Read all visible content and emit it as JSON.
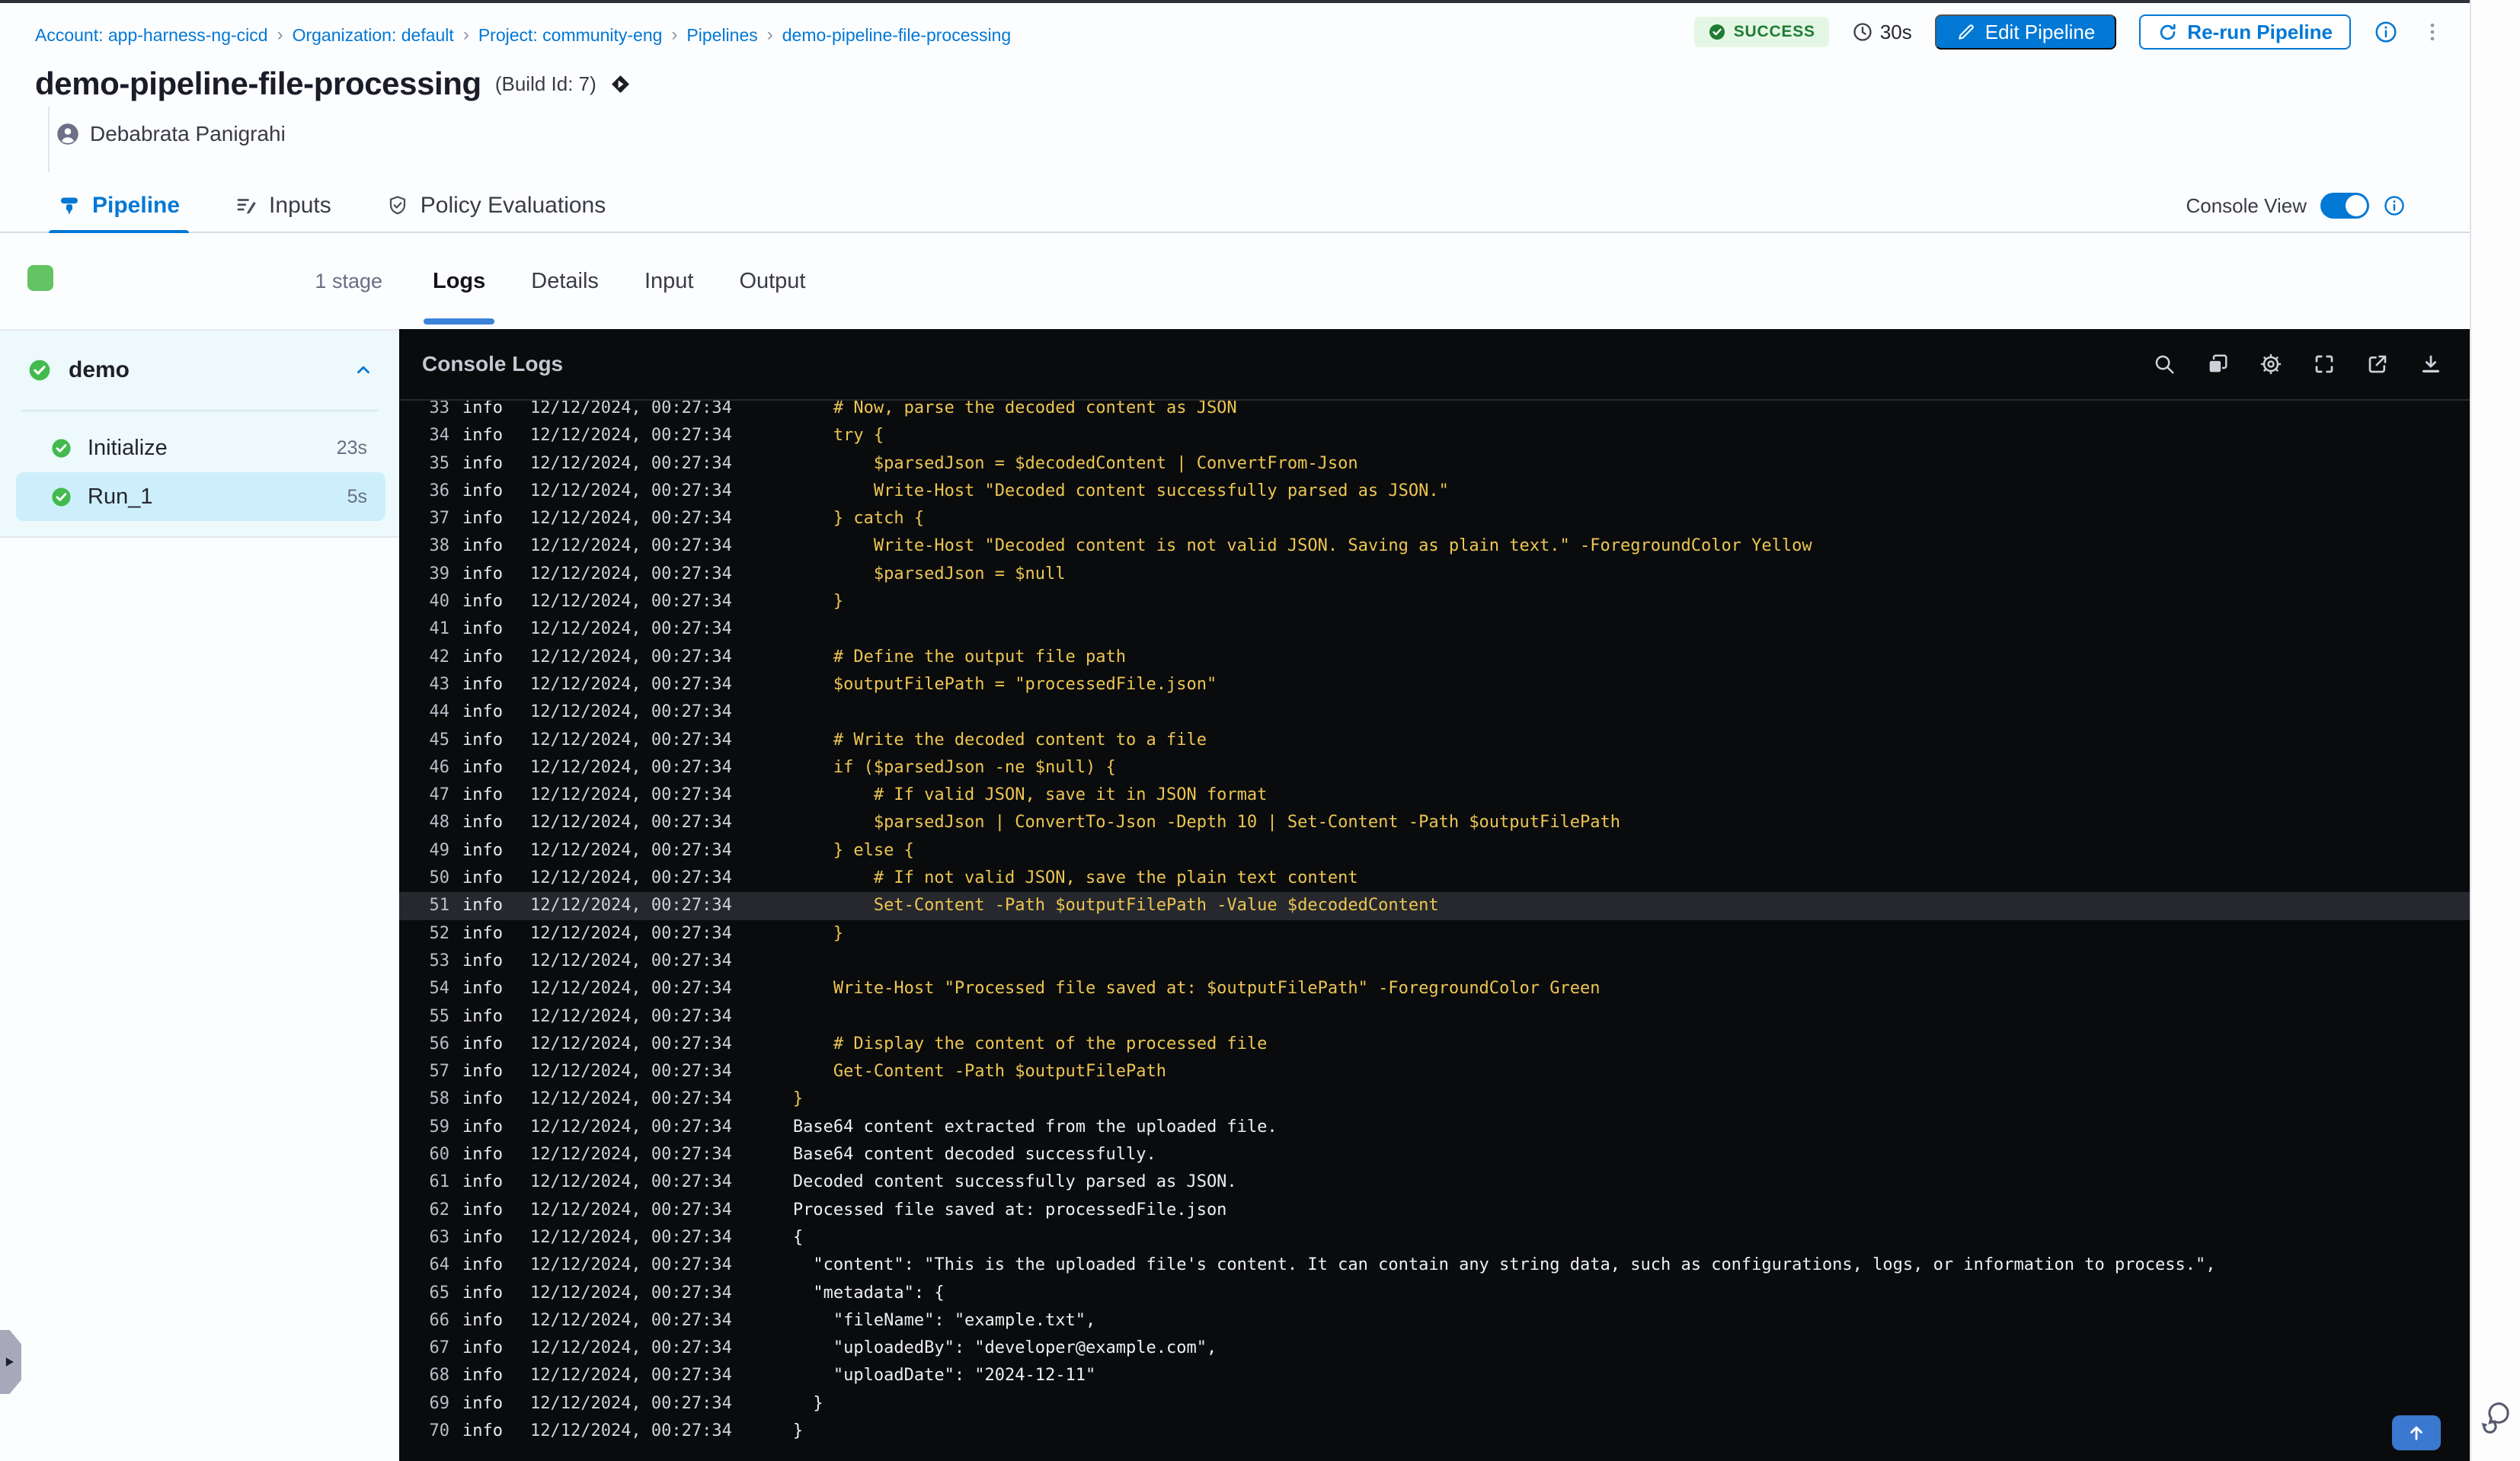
{
  "colors": {
    "accent_blue": "#0278d5",
    "success_green": "#1e7b33",
    "success_badge_bg": "#e4f7e4",
    "stage_square_green": "#62c463",
    "step_check_green": "#42ba4e",
    "stage_section_bg": "#edf9fb",
    "selected_step_bg": "#cdeffc",
    "console_bg": "#0a0b0d",
    "log_yellow": "#ecc653",
    "log_white": "#edeff1",
    "highlight_row_bg": "#26282d"
  },
  "breadcrumb": {
    "separator": "›",
    "items": [
      "Account: app-harness-ng-cicd",
      "Organization: default",
      "Project: community-eng",
      "Pipelines",
      "demo-pipeline-file-processing"
    ]
  },
  "header": {
    "title": "demo-pipeline-file-processing",
    "build_id": "(Build Id: 7)",
    "author": "Debabrata Panigrahi",
    "status_badge": "SUCCESS",
    "duration": "30s",
    "edit_button": "Edit Pipeline",
    "rerun_button": "Re-run Pipeline"
  },
  "main_tabs": [
    {
      "label": "Pipeline",
      "icon": "pipeline-icon",
      "active": true
    },
    {
      "label": "Inputs",
      "icon": "inputs-icon",
      "active": false
    },
    {
      "label": "Policy Evaluations",
      "icon": "shield-check-icon",
      "active": false
    }
  ],
  "console_view": {
    "label": "Console View",
    "enabled": true
  },
  "sidebar": {
    "stage_count": "1 stage",
    "stage_name": "demo",
    "steps": [
      {
        "name": "Initialize",
        "duration": "23s",
        "selected": false
      },
      {
        "name": "Run_1",
        "duration": "5s",
        "selected": true
      }
    ]
  },
  "log_tabs": [
    {
      "label": "Logs",
      "active": true
    },
    {
      "label": "Details",
      "active": false
    },
    {
      "label": "Input",
      "active": false
    },
    {
      "label": "Output",
      "active": false
    }
  ],
  "console": {
    "title": "Console Logs",
    "toolbar_icons": [
      "search-icon",
      "copy-icon",
      "settings-icon",
      "fullscreen-icon",
      "open-in-new-icon",
      "download-icon"
    ],
    "level": "info",
    "timestamp": "12/12/2024, 00:27:34",
    "highlighted_line": 51,
    "lines": [
      {
        "n": 33,
        "tone": "yellow",
        "code": "    # Now, parse the decoded content as JSON"
      },
      {
        "n": 34,
        "tone": "yellow",
        "code": "    try {"
      },
      {
        "n": 35,
        "tone": "yellow",
        "code": "        $parsedJson = $decodedContent | ConvertFrom-Json"
      },
      {
        "n": 36,
        "tone": "yellow",
        "code": "        Write-Host \"Decoded content successfully parsed as JSON.\""
      },
      {
        "n": 37,
        "tone": "yellow",
        "code": "    } catch {"
      },
      {
        "n": 38,
        "tone": "yellow",
        "code": "        Write-Host \"Decoded content is not valid JSON. Saving as plain text.\" -ForegroundColor Yellow"
      },
      {
        "n": 39,
        "tone": "yellow",
        "code": "        $parsedJson = $null"
      },
      {
        "n": 40,
        "tone": "yellow",
        "code": "    }"
      },
      {
        "n": 41,
        "tone": "yellow",
        "code": ""
      },
      {
        "n": 42,
        "tone": "yellow",
        "code": "    # Define the output file path"
      },
      {
        "n": 43,
        "tone": "yellow",
        "code": "    $outputFilePath = \"processedFile.json\""
      },
      {
        "n": 44,
        "tone": "yellow",
        "code": ""
      },
      {
        "n": 45,
        "tone": "yellow",
        "code": "    # Write the decoded content to a file"
      },
      {
        "n": 46,
        "tone": "yellow",
        "code": "    if ($parsedJson -ne $null) {"
      },
      {
        "n": 47,
        "tone": "yellow",
        "code": "        # If valid JSON, save it in JSON format"
      },
      {
        "n": 48,
        "tone": "yellow",
        "code": "        $parsedJson | ConvertTo-Json -Depth 10 | Set-Content -Path $outputFilePath"
      },
      {
        "n": 49,
        "tone": "yellow",
        "code": "    } else {"
      },
      {
        "n": 50,
        "tone": "yellow",
        "code": "        # If not valid JSON, save the plain text content"
      },
      {
        "n": 51,
        "tone": "yellow",
        "code": "        Set-Content -Path $outputFilePath -Value $decodedContent"
      },
      {
        "n": 52,
        "tone": "yellow",
        "code": "    }"
      },
      {
        "n": 53,
        "tone": "yellow",
        "code": ""
      },
      {
        "n": 54,
        "tone": "yellow",
        "code": "    Write-Host \"Processed file saved at: $outputFilePath\" -ForegroundColor Green"
      },
      {
        "n": 55,
        "tone": "yellow",
        "code": ""
      },
      {
        "n": 56,
        "tone": "yellow",
        "code": "    # Display the content of the processed file"
      },
      {
        "n": 57,
        "tone": "yellow",
        "code": "    Get-Content -Path $outputFilePath"
      },
      {
        "n": 58,
        "tone": "yellow",
        "code": "}"
      },
      {
        "n": 59,
        "tone": "white",
        "code": "Base64 content extracted from the uploaded file."
      },
      {
        "n": 60,
        "tone": "white",
        "code": "Base64 content decoded successfully."
      },
      {
        "n": 61,
        "tone": "white",
        "code": "Decoded content successfully parsed as JSON."
      },
      {
        "n": 62,
        "tone": "white",
        "code": "Processed file saved at: processedFile.json"
      },
      {
        "n": 63,
        "tone": "white",
        "code": "{"
      },
      {
        "n": 64,
        "tone": "white",
        "code": "  \"content\": \"This is the uploaded file's content. It can contain any string data, such as configurations, logs, or information to process.\","
      },
      {
        "n": 65,
        "tone": "white",
        "code": "  \"metadata\": {"
      },
      {
        "n": 66,
        "tone": "white",
        "code": "    \"fileName\": \"example.txt\","
      },
      {
        "n": 67,
        "tone": "white",
        "code": "    \"uploadedBy\": \"developer@example.com\","
      },
      {
        "n": 68,
        "tone": "white",
        "code": "    \"uploadDate\": \"2024-12-11\""
      },
      {
        "n": 69,
        "tone": "white",
        "code": "  }"
      },
      {
        "n": 70,
        "tone": "white",
        "code": "}"
      }
    ]
  }
}
